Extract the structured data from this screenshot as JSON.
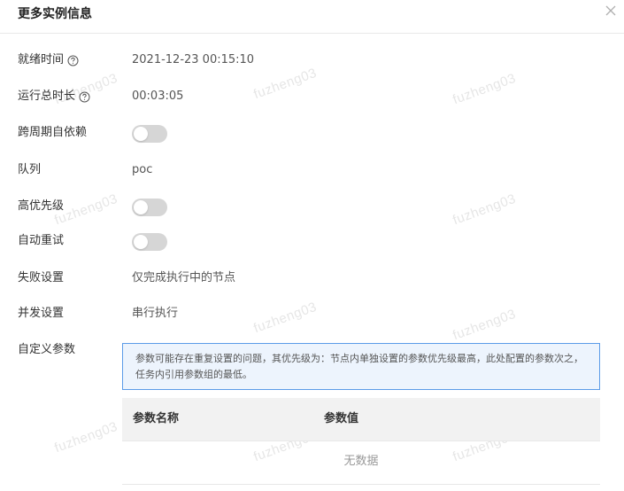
{
  "dialog": {
    "title": "更多实例信息",
    "close_icon": "close-icon"
  },
  "fields": {
    "ready_time": {
      "label": "就绪时间",
      "value": "2021-12-23 00:15:10"
    },
    "total_runtime": {
      "label": "运行总时长",
      "value": "00:03:05"
    },
    "cross_cycle": {
      "label": "跨周期自依赖",
      "enabled": false
    },
    "queue": {
      "label": "队列",
      "value": "poc"
    },
    "high_priority": {
      "label": "高优先级",
      "enabled": false
    },
    "auto_retry": {
      "label": "自动重试",
      "enabled": false
    },
    "failure_setting": {
      "label": "失败设置",
      "value": "仅完成执行中的节点"
    },
    "concurrency_setting": {
      "label": "并发设置",
      "value": "串行执行"
    },
    "custom_params": {
      "label": "自定义参数"
    }
  },
  "notice": {
    "text": "参数可能存在重复设置的问题，其优先级为：节点内单独设置的参数优先级最高，此处配置的参数次之，任务内引用参数组的最低。"
  },
  "params_table": {
    "columns": [
      "参数名称",
      "参数值"
    ],
    "empty_text": "无数据"
  },
  "watermark": "fuzheng03",
  "colors": {
    "accent": "#5b9be8",
    "notice_bg": "#edf4fd",
    "toggle_off": "#d6d6d6"
  }
}
